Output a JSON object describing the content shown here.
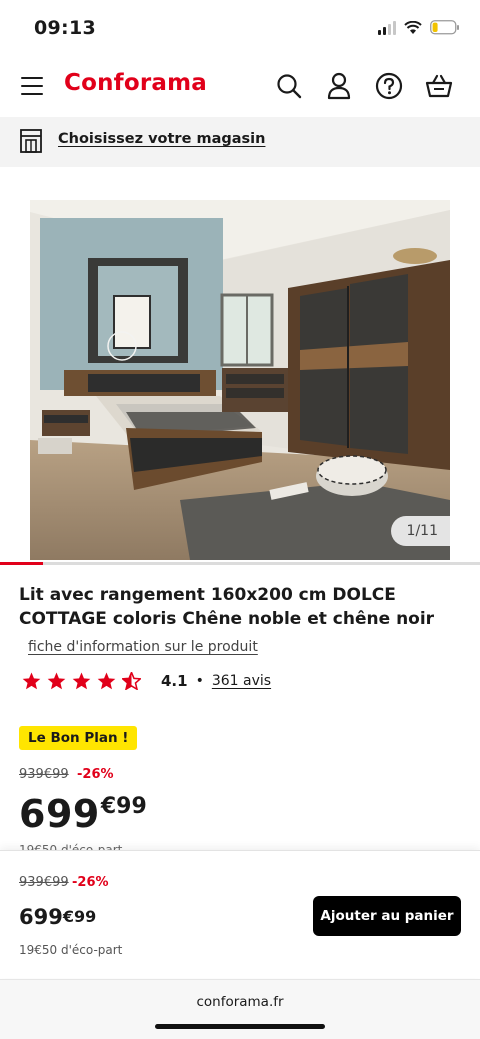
{
  "status_bar": {
    "time": "09:13"
  },
  "header": {
    "logo": "Conforama",
    "icons": [
      "menu-icon",
      "search-icon",
      "account-icon",
      "help-icon",
      "basket-icon"
    ]
  },
  "store": {
    "label": "Choisissez votre magasin"
  },
  "gallery": {
    "counter": "1/11",
    "progress_fraction": 0.09
  },
  "product": {
    "title": "Lit avec rangement 160x200 cm DOLCE COTTAGE coloris Chêne noble et chêne noir",
    "info_link": "fiche d'information sur le produit",
    "rating": {
      "stars": 4.5,
      "value": "4.1",
      "separator": "•",
      "reviews": "361 avis"
    }
  },
  "pricing": {
    "badge": "Le Bon Plan !",
    "old_price": "939€99",
    "discount": "-26%",
    "price_int": "699",
    "price_cents": "€99"
  },
  "sticky_bar": {
    "old_price": "939€99",
    "discount": "-26%",
    "price_int": "699",
    "price_cents": "€99",
    "eco": "19€50 d'éco-part",
    "cart_button": "Ajouter au panier"
  },
  "browser": {
    "url": "conforama.fr"
  },
  "colors": {
    "brand": "#e1001a",
    "badge": "#ffe500",
    "button": "#000000"
  }
}
